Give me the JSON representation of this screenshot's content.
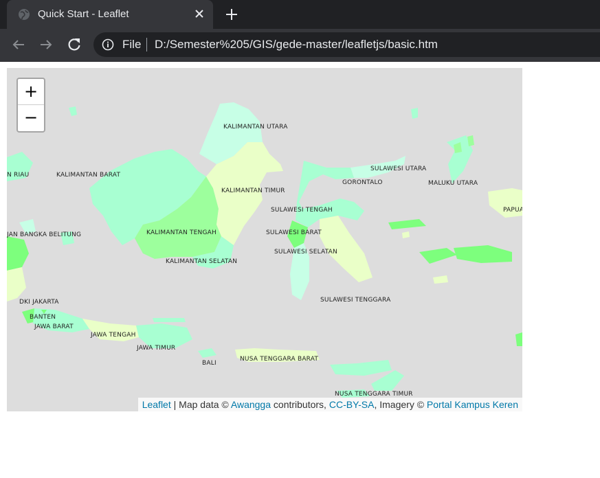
{
  "browser": {
    "tab_title": "Quick Start - Leaflet",
    "scheme_label": "File",
    "url": "D:/Semester%205/GIS/gede-master/leafletjs/basic.htm",
    "icons": {
      "favicon": "globe-icon",
      "close": "close-icon",
      "new_tab": "plus-icon",
      "back": "arrow-left-icon",
      "forward": "arrow-right-icon",
      "reload": "reload-icon",
      "info": "info-icon"
    }
  },
  "map": {
    "zoom_in_label": "+",
    "zoom_out_label": "−",
    "labels": {
      "kalimantan_utara": "KALIMANTAN UTARA",
      "riau": "N RIAU",
      "kalimantan_barat": "KALIMANTAN BARAT",
      "kalimantan_timur": "KALIMANTAN TIMUR",
      "sulawesi_utara": "SULAWESI UTARA",
      "gorontalo": "GORONTALO",
      "maluku_utara": "MALUKU UTARA",
      "sulawesi_tengah": "SULAWESI TENGAH",
      "papua": "PAPUA",
      "bangka_belitung": "JAN BANGKA BELITUNG",
      "kalimantan_tengah": "KALIMANTAN TENGAH",
      "sulawesi_barat": "SULAWESI BARAT",
      "sulawesi_selatan": "SULAWESI SELATAN",
      "kalimantan_selatan": "KALIMANTAN SELATAN",
      "dki_jakarta": "DKI JAKARTA",
      "sulawesi_tenggara": "SULAWESI TENGGARA",
      "banten": "BANTEN",
      "jawa_barat": "JAWA BARAT",
      "jawa_tengah": "JAWA TENGAH",
      "jawa_timur": "JAWA TIMUR",
      "bali": "BALI",
      "ntb": "NUSA TENGGARA BARAT",
      "ntt": "NUSA TENGGARA TIMUR"
    },
    "colors": {
      "background": "#dddddd",
      "green": "#9dff9d",
      "mint": "#a8ffd2",
      "pale": "#eaffc8",
      "bright": "#7dff7d"
    },
    "attribution": {
      "leaflet": "Leaflet",
      "text1": " | Map data © ",
      "awangga": "Awangga",
      "text2": " contributors, ",
      "license": "CC-BY-SA",
      "text3": ", Imagery © ",
      "imagery": "Portal Kampus Keren"
    }
  }
}
